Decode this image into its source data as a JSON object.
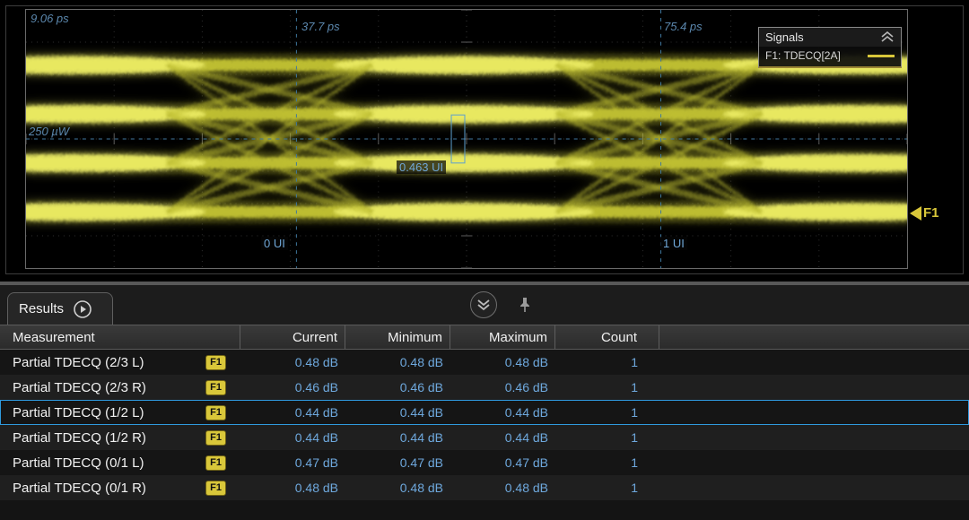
{
  "scope": {
    "annotations": {
      "delta_time": "9.06 ps",
      "cursor_a": "37.7 ps",
      "cursor_b": "75.4 ps",
      "amplitude": "250 µW",
      "ui_position": "0.463 UI",
      "ui_start": "0 UI",
      "ui_end": "1 UI"
    },
    "signals_panel": {
      "title": "Signals",
      "signal": "F1: TDECQ[2A]"
    },
    "trace_marker": "F1"
  },
  "results": {
    "tab_label": "Results",
    "table": {
      "columns": [
        "Measurement",
        "Current",
        "Minimum",
        "Maximum",
        "Count"
      ],
      "rows": [
        {
          "name": "Partial TDECQ (2/3 L)",
          "source": "F1",
          "current": "0.48 dB",
          "minimum": "0.48 dB",
          "maximum": "0.48 dB",
          "count": "1",
          "selected": false
        },
        {
          "name": "Partial TDECQ (2/3 R)",
          "source": "F1",
          "current": "0.46 dB",
          "minimum": "0.46 dB",
          "maximum": "0.46 dB",
          "count": "1",
          "selected": false
        },
        {
          "name": "Partial TDECQ (1/2 L)",
          "source": "F1",
          "current": "0.44 dB",
          "minimum": "0.44 dB",
          "maximum": "0.44 dB",
          "count": "1",
          "selected": true
        },
        {
          "name": "Partial TDECQ (1/2 R)",
          "source": "F1",
          "current": "0.44 dB",
          "minimum": "0.44 dB",
          "maximum": "0.44 dB",
          "count": "1",
          "selected": false
        },
        {
          "name": "Partial TDECQ (0/1 L)",
          "source": "F1",
          "current": "0.47 dB",
          "minimum": "0.47 dB",
          "maximum": "0.47 dB",
          "count": "1",
          "selected": false
        },
        {
          "name": "Partial TDECQ (0/1 R)",
          "source": "F1",
          "current": "0.48 dB",
          "minimum": "0.48 dB",
          "maximum": "0.48 dB",
          "count": "1",
          "selected": false
        }
      ]
    }
  },
  "colors": {
    "trace": "#d2d23a",
    "annotation": "#5b87ad",
    "value_blue": "#6ea8dd",
    "badge_yellow": "#d9c73a",
    "selection_border": "#2f9ade"
  }
}
